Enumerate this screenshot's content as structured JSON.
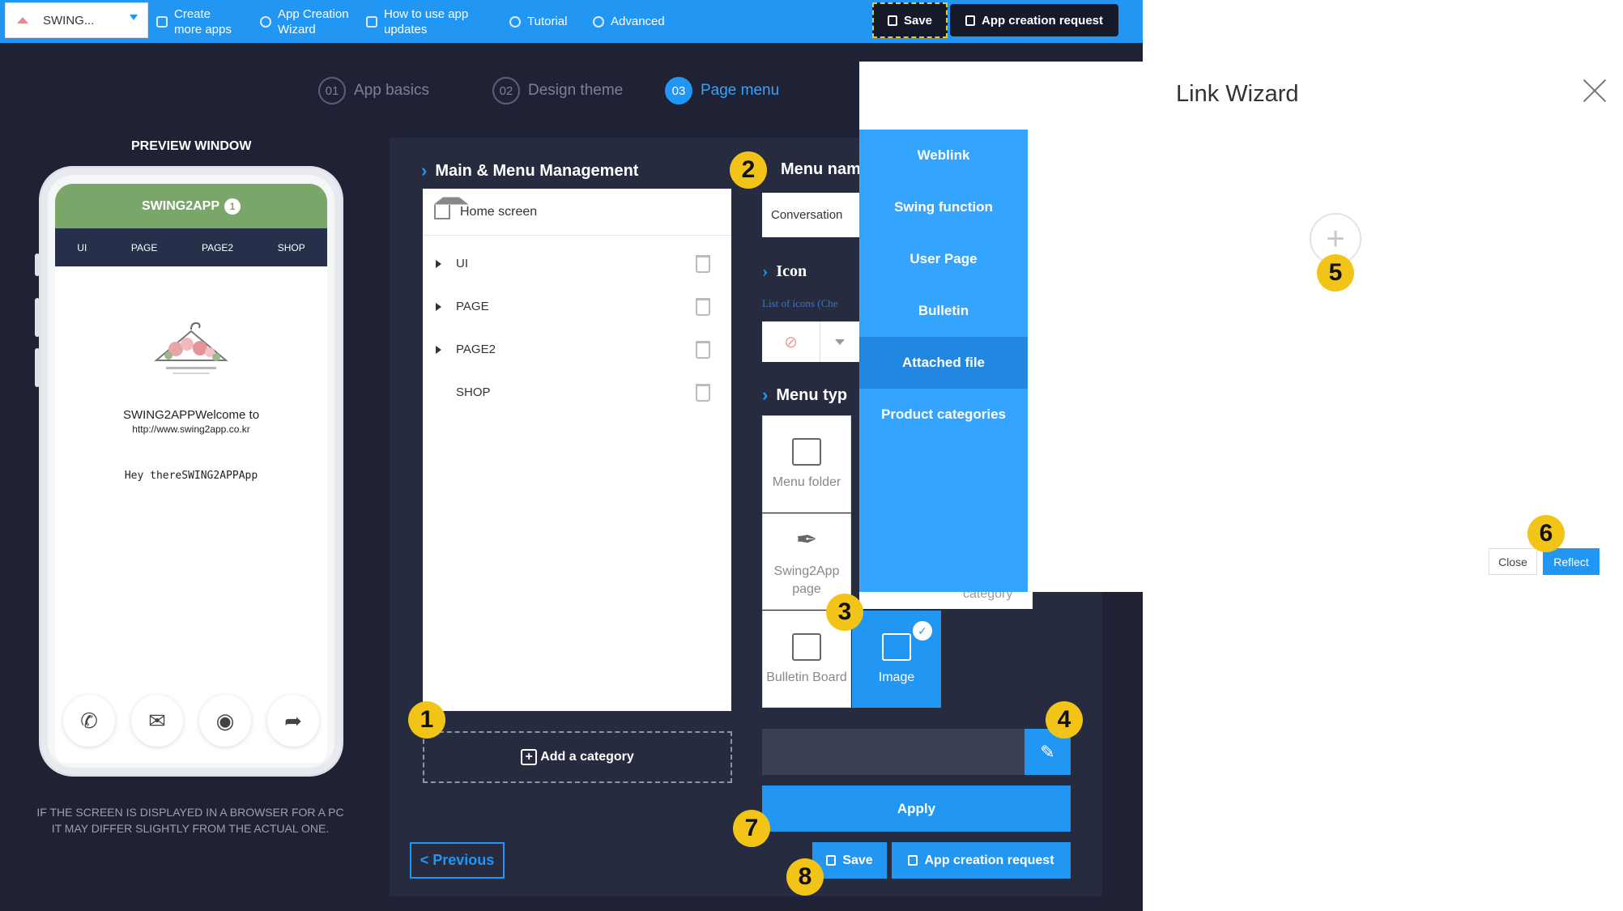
{
  "topbar": {
    "app_name": "SWING...",
    "items": [
      {
        "label": "Create more apps"
      },
      {
        "label": "App Creation Wizard"
      },
      {
        "label": "How to use app updates"
      },
      {
        "label": "Tutorial"
      },
      {
        "label": "Advanced"
      }
    ],
    "save_label": "Save",
    "request_label": "App creation request"
  },
  "steps": [
    {
      "num": "01",
      "label": "App basics"
    },
    {
      "num": "02",
      "label": "Design theme"
    },
    {
      "num": "03",
      "label": "Page menu"
    }
  ],
  "preview": {
    "title": "PREVIEW WINDOW",
    "app_title": "SWING2APP",
    "badge": "1",
    "nav": [
      "UI",
      "PAGE",
      "PAGE2",
      "SHOP"
    ],
    "welcome": "SWING2APPWelcome to",
    "url": "http://www.swing2app.co.kr",
    "hey": "Hey thereSWING2APPApp",
    "note_line1": "IF THE SCREEN IS DISPLAYED IN A BROWSER FOR A PC",
    "note_line2": "IT MAY DIFFER SLIGHTLY FROM THE ACTUAL ONE."
  },
  "main": {
    "title": "Main & Menu Management",
    "home": "Home screen",
    "categories": [
      "UI",
      "PAGE",
      "PAGE2",
      "SHOP"
    ],
    "add_category": "Add a category",
    "previous": "< Previous"
  },
  "menu_name": {
    "title": "Menu nam",
    "value": "Conversation"
  },
  "icon": {
    "title": "Icon",
    "list_text": "List of icons (Che"
  },
  "menu_type": {
    "title": "Menu typ",
    "tiles": [
      {
        "label": "Menu folder"
      },
      {
        "label": "Swing2App page"
      },
      {
        "label": "Bulletin Board"
      },
      {
        "label": "Image"
      }
    ],
    "partial_label": "category"
  },
  "link_menu": {
    "items": [
      "Weblink",
      "Swing function",
      "User Page",
      "Bulletin",
      "Attached file",
      "Product categories"
    ],
    "selected": "Attached file"
  },
  "actions": {
    "apply": "Apply",
    "save": "Save",
    "request": "App creation request"
  },
  "wizard": {
    "title": "Link Wizard",
    "close": "Close",
    "reflect": "Reflect"
  },
  "callouts": [
    "1",
    "2",
    "3",
    "4",
    "5",
    "6",
    "7",
    "8"
  ],
  "colors": {
    "accent": "#2196f3",
    "callout": "#f3c418",
    "background": "#1f2235",
    "phone_header": "#7aa66a"
  }
}
